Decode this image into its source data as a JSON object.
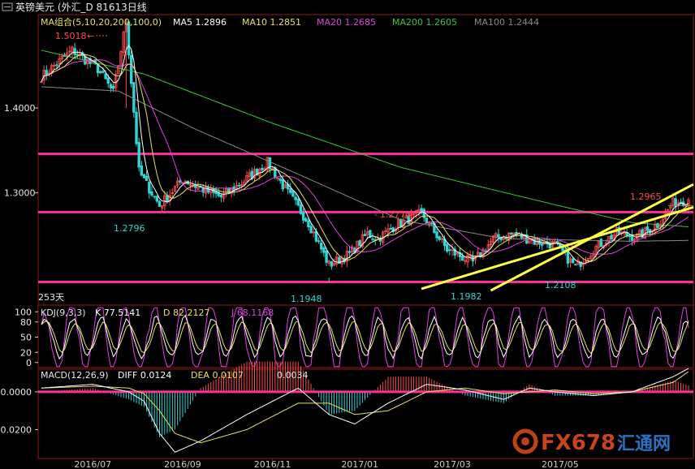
{
  "window": {
    "title": "英镑美元 (外汇_D 81613日线"
  },
  "colors": {
    "bg": "#000000",
    "axis": "#8a1a1a",
    "up": "#ff4b4b",
    "down": "#2fd6d6",
    "ma5": "#ffffff",
    "ma10": "#e8e25a",
    "ma20": "#e040e0",
    "ma200": "#3cc43c",
    "ma100": "#888888",
    "hline": "#ff2f9a",
    "trend": "#ffff44",
    "k": "#ffffff",
    "d": "#e8e25a",
    "j": "#e040e0",
    "diff": "#ffffff",
    "dea": "#e8e25a",
    "zero": "#ff2f9a"
  },
  "main_panel": {
    "legend": {
      "name": "MA组合(5,10,20,200,100,0)",
      "ma5": "MA5  1.2896",
      "ma10": "MA10  1.2851",
      "ma20": "MA20  1.2685",
      "ma200": "MA200  1.2605",
      "ma100": "MA100  1.2444"
    },
    "period_label": "253天",
    "annotations": {
      "high": "1.5018",
      "low1": "1.2796",
      "low2": "1.1948",
      "mid_high": "1.2774",
      "low3": "1.1982",
      "low4": "1.2108",
      "recent_high": "1.2965"
    }
  },
  "kdj_panel": {
    "name": "KDJ(9,3,3)",
    "k": "K  77.5141",
    "d": "D  82.2127",
    "j": "J  68.1168"
  },
  "macd_panel": {
    "name": "MACD(12,26,9)",
    "diff": "DIFF  0.0124",
    "dea": "DEA  0.0107",
    "macd": "0.0034"
  },
  "watermark": {
    "brand": "FX678",
    "cn": "汇通网"
  },
  "chart_data": [
    {
      "type": "line",
      "title": "英镑美元 日线",
      "x_ticks": [
        "2016/07",
        "2016/09",
        "2016/11",
        "2017/01",
        "2017/03",
        "2017/05"
      ],
      "y_ticks": [
        "1.4000",
        "1.3000"
      ],
      "ylim": [
        1.185,
        1.51
      ],
      "horizontal_lines": [
        1.346,
        1.2774,
        1.195
      ],
      "anchors": {
        "x": [
          0,
          12,
          22,
          28,
          33,
          38,
          46,
          55,
          62,
          70,
          78,
          88,
          96,
          104,
          112,
          120,
          127,
          131,
          138,
          148,
          158,
          168,
          176,
          184,
          192,
          200,
          208,
          216,
          224,
          232,
          240,
          246,
          252
        ],
        "close": [
          1.437,
          1.468,
          1.446,
          1.418,
          1.502,
          1.325,
          1.285,
          1.316,
          1.305,
          1.295,
          1.312,
          1.336,
          1.3,
          1.265,
          1.215,
          1.228,
          1.252,
          1.246,
          1.262,
          1.276,
          1.233,
          1.218,
          1.246,
          1.252,
          1.243,
          1.239,
          1.213,
          1.236,
          1.253,
          1.248,
          1.263,
          1.288,
          1.292
        ]
      },
      "ma200": {
        "x": [
          0,
          40,
          90,
          140,
          200,
          230,
          252
        ],
        "values": [
          1.468,
          1.44,
          1.382,
          1.33,
          1.286,
          1.265,
          1.26
        ]
      },
      "ma100": {
        "x": [
          0,
          30,
          60,
          100,
          140,
          180,
          230,
          252
        ],
        "values": [
          1.425,
          1.42,
          1.375,
          1.322,
          1.268,
          1.246,
          1.243,
          1.244
        ]
      }
    },
    {
      "type": "line",
      "title": "KDJ(9,3,3)",
      "y_ticks": [
        "100",
        "80",
        "50",
        "20",
        "0"
      ],
      "ylim": [
        -10,
        110
      ],
      "k_last": 77.5141,
      "d_last": 82.2127,
      "j_last": 68.1168
    },
    {
      "type": "bar",
      "title": "MACD(12,26,9)",
      "y_ticks": [
        "0.0000",
        "-0.0200"
      ],
      "ylim": [
        -0.034,
        0.012
      ],
      "diff": {
        "x": [
          0,
          20,
          34,
          40,
          46,
          52,
          62,
          80,
          100,
          112,
          122,
          135,
          150,
          165,
          180,
          190,
          200,
          215,
          230,
          246,
          252
        ],
        "values": [
          0.002,
          0.004,
          0.0,
          -0.005,
          -0.022,
          -0.032,
          -0.026,
          -0.012,
          0.002,
          -0.012,
          -0.017,
          -0.006,
          0.004,
          0.001,
          -0.004,
          0.002,
          0.0,
          -0.002,
          0.0,
          0.008,
          0.0124
        ]
      },
      "dea": {
        "x": [
          0,
          20,
          34,
          40,
          46,
          52,
          62,
          80,
          100,
          112,
          122,
          135,
          150,
          165,
          180,
          190,
          200,
          215,
          230,
          246,
          252
        ],
        "values": [
          0.002,
          0.003,
          0.002,
          -0.001,
          -0.01,
          -0.022,
          -0.027,
          -0.02,
          -0.006,
          -0.006,
          -0.012,
          -0.01,
          0.0,
          0.002,
          -0.001,
          0.0,
          0.001,
          -0.001,
          0.0,
          0.005,
          0.0107
        ]
      }
    }
  ]
}
